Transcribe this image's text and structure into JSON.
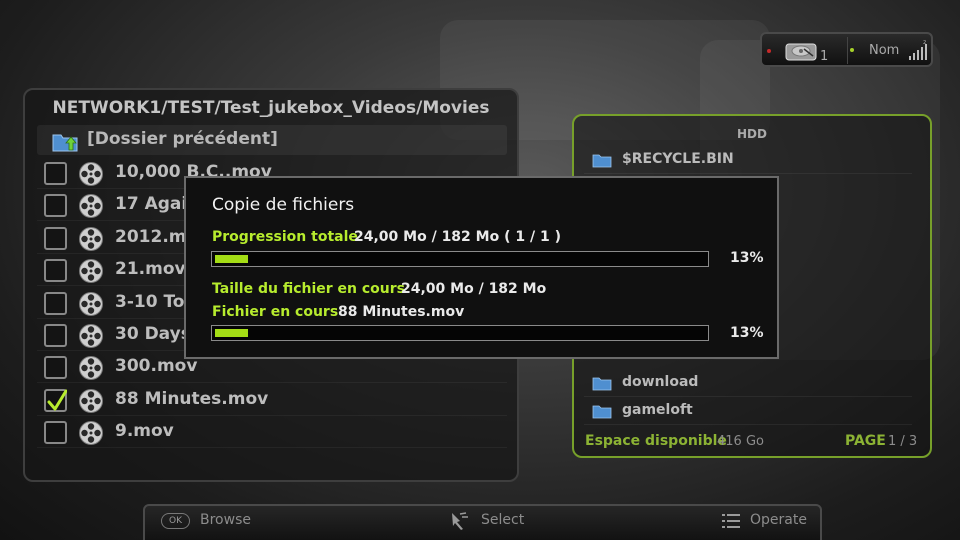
{
  "status": {
    "hdd_count": "1",
    "sort_label": "Nom"
  },
  "browser": {
    "path": "NETWORK1/TEST/Test_jukebox_Videos/Movies",
    "parent_label": "[Dossier précédent]",
    "files": [
      {
        "name": "10,000 B.C..mov",
        "checked": false
      },
      {
        "name": "17 Again.mov",
        "checked": false
      },
      {
        "name": "2012.mov",
        "checked": false
      },
      {
        "name": "21.mov",
        "checked": false
      },
      {
        "name": "3-10 To Yuma.mov",
        "checked": false
      },
      {
        "name": "30 Days of Night.mov",
        "checked": false
      },
      {
        "name": "300.mov",
        "checked": false
      },
      {
        "name": "88 Minutes.mov",
        "checked": true
      },
      {
        "name": "9.mov",
        "checked": false
      }
    ]
  },
  "hdd_panel": {
    "title": "HDD",
    "folders": [
      {
        "name": "$RECYCLE.BIN"
      },
      {
        "name": "download"
      },
      {
        "name": "gameloft"
      }
    ],
    "space_label": "Espace disponible",
    "space_value": "416 Go",
    "page_label": "PAGE",
    "page_value": "1 / 3"
  },
  "copy_dialog": {
    "title": "Copie de fichiers",
    "total_label": "Progression totale",
    "total_value": "24,00 Mo / 182 Mo ( 1 / 1 )",
    "total_percent": "13%",
    "total_progress": 0.13,
    "file_size_label": "Taille du fichier en cours",
    "file_size_value": "24,00 Mo / 182 Mo",
    "current_file_label": "Fichier en cours",
    "current_file_value": "88 Minutes.mov",
    "file_percent": "13%",
    "file_progress": 0.13
  },
  "hints": {
    "ok_key": "OK",
    "browse": "Browse",
    "select": "Select",
    "operate": "Operate"
  },
  "colors": {
    "accent_green": "#b7ec2e",
    "progress_fill": "#a4dd15",
    "panel_border_green": "#77a02a"
  }
}
